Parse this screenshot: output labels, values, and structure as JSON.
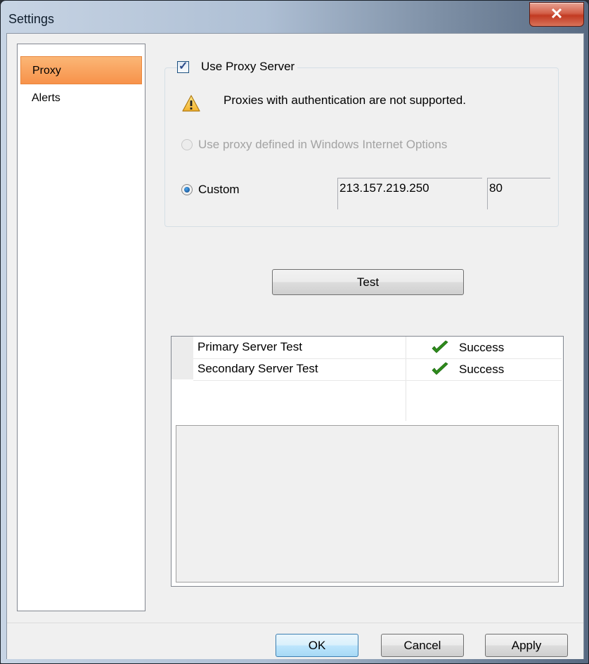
{
  "window": {
    "title": "Settings",
    "close_glyph": "✕"
  },
  "sidebar": {
    "items": [
      {
        "label": "Proxy",
        "selected": true
      },
      {
        "label": "Alerts",
        "selected": false
      }
    ]
  },
  "proxy": {
    "use_proxy_label": "Use Proxy Server",
    "use_proxy_checked": true,
    "warning_text": "Proxies with authentication are not supported.",
    "warning_icon": "warning-icon",
    "option_windows_label": "Use proxy defined in Windows Internet Options",
    "option_windows_enabled": false,
    "option_custom_label": "Custom",
    "option_custom_selected": true,
    "host_value": "213.157.219.250",
    "port_value": "80"
  },
  "test_button_label": "Test",
  "results": {
    "rows": [
      {
        "name": "Primary Server Test",
        "status": "Success",
        "status_icon": "checkmark-icon"
      },
      {
        "name": "Secondary Server Test",
        "status": "Success",
        "status_icon": "checkmark-icon"
      }
    ]
  },
  "footer": {
    "ok_label": "OK",
    "cancel_label": "Cancel",
    "apply_label": "Apply"
  },
  "colors": {
    "selected_item": "#f7924a",
    "close_button": "#c23a22",
    "checkmark": "#2e8b1c"
  }
}
